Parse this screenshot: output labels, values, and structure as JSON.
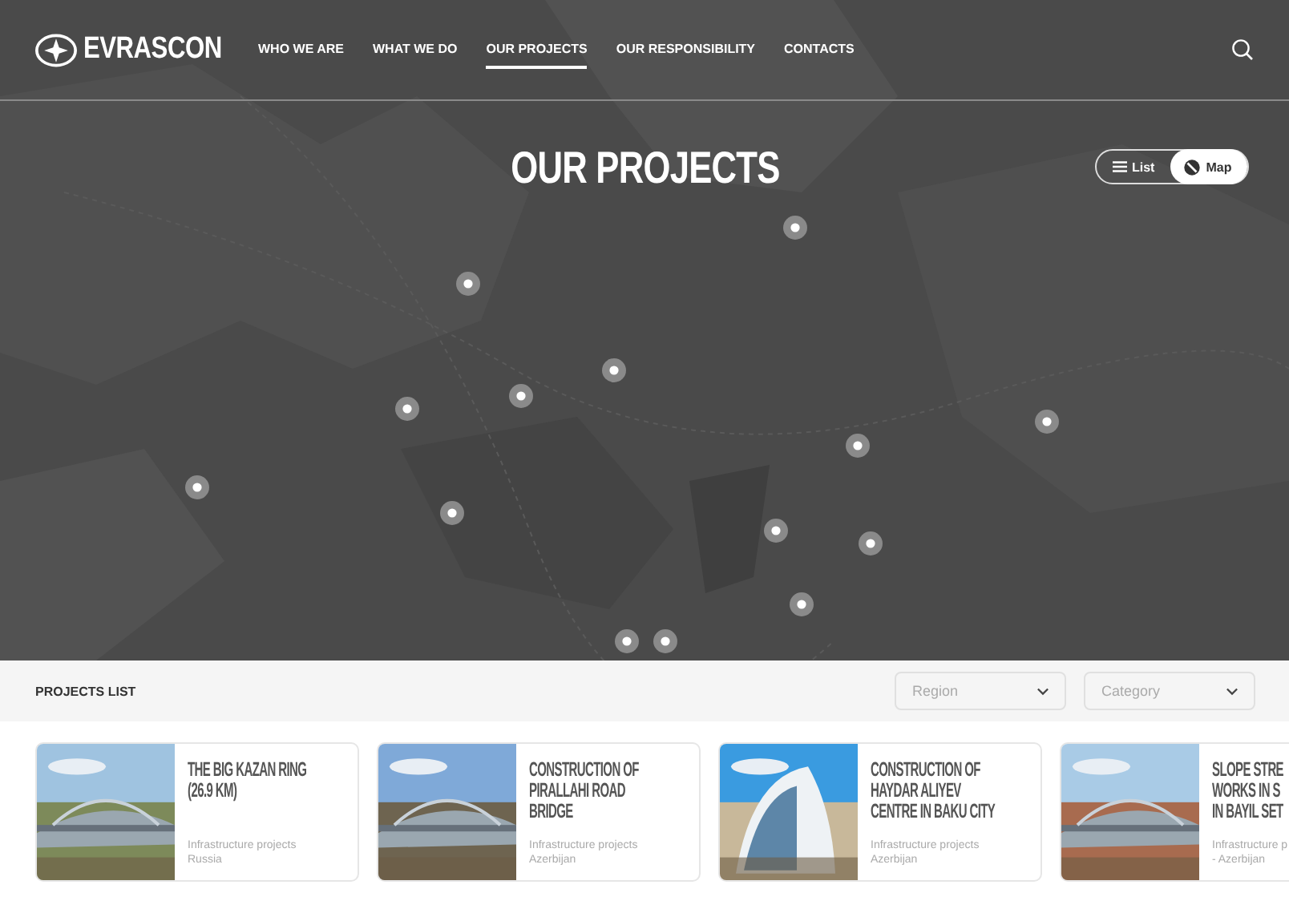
{
  "header": {
    "logo": "EVRASCON",
    "nav": [
      {
        "label": "WHO WE ARE",
        "selected": false
      },
      {
        "label": "WHAT WE DO",
        "selected": false
      },
      {
        "label": "OUR PROJECTS",
        "selected": true
      },
      {
        "label": "OUR RESPONSIBILITY",
        "selected": false
      },
      {
        "label": "CONTACTS",
        "selected": false
      }
    ]
  },
  "map": {
    "title": "OUR PROJECTS",
    "view_toggle": [
      {
        "label": "List",
        "selected": false
      },
      {
        "label": "Map",
        "selected": true
      }
    ]
  },
  "projects_list": {
    "title": "PROJECTS LIST",
    "filters": [
      {
        "placeholder": "Region"
      },
      {
        "placeholder": "Category"
      }
    ],
    "cards": [
      {
        "title": [
          "THE BIG KAZAN RING",
          "(26.9 KM)"
        ],
        "category": "Infrastructure projects",
        "country": "Russia"
      },
      {
        "title": [
          "CONSTRUCTION OF",
          "PIRALLAHI ROAD",
          "BRIDGE"
        ],
        "category": "Infrastructure projects",
        "country": "Azerbijan"
      },
      {
        "title": [
          "CONSTRUCTION OF",
          "HAYDAR ALIYEV",
          "CENTRE IN BAKU CITY"
        ],
        "category": "Infrastructure projects",
        "country": "Azerbijan"
      },
      {
        "title": [
          "SLOPE STRE",
          "WORKS IN S",
          "IN BAYIL SET"
        ],
        "category": "Infrastructure p",
        "country": "- Azerbijan"
      }
    ]
  }
}
